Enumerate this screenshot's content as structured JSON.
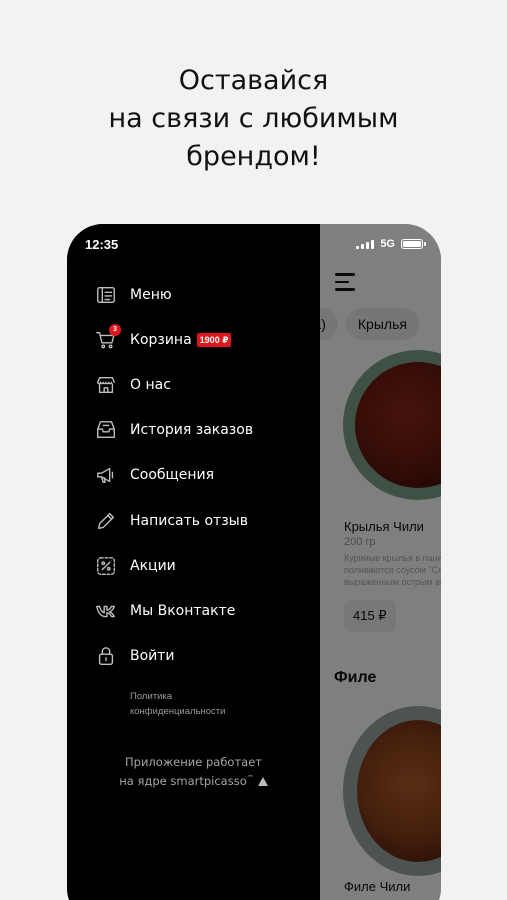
{
  "headline": [
    "Оставайся",
    "на связи с любимым",
    "брендом!"
  ],
  "status": {
    "time": "12:35",
    "network": "5G"
  },
  "menu": [
    {
      "label": "Меню",
      "icon": "menu-book-icon"
    },
    {
      "label": "Корзина",
      "icon": "cart-icon",
      "badge": "3",
      "amount": "1900 ₽"
    },
    {
      "label": "О нас",
      "icon": "store-icon"
    },
    {
      "label": "История заказов",
      "icon": "order-history-icon"
    },
    {
      "label": "Сообщения",
      "icon": "megaphone-icon"
    },
    {
      "label": "Написать отзыв",
      "icon": "pencil-icon"
    },
    {
      "label": "Акции",
      "icon": "discount-icon"
    },
    {
      "label": "Мы Вконтакте",
      "icon": "vk-icon"
    },
    {
      "label": "Войти",
      "icon": "lock-icon"
    }
  ],
  "policy": [
    "Политика",
    "конфиденциальности"
  ],
  "powered": [
    "Приложение работает",
    "на ядре smartpicasso",
    "™"
  ],
  "background_app": {
    "chips": [
      "ка)",
      "Крылья"
    ],
    "product1": {
      "name": "Крылья Чили",
      "weight": "200 гр",
      "description": [
        "Куриные крылья в панировке",
        "поливаются соусом \"Сладкий",
        "выраженным острым вкусом"
      ],
      "price": "415 ₽"
    },
    "section": "Филе",
    "product2": {
      "name": "Филе Чили"
    }
  },
  "colors": {
    "accent": "#e0161d",
    "drawer": "#000000",
    "background": "#f2f2f2"
  }
}
